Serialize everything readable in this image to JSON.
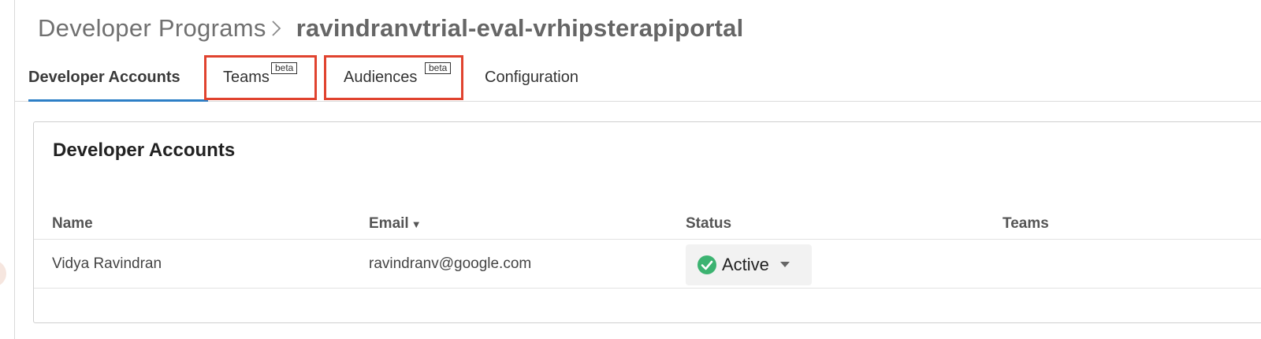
{
  "breadcrumb": {
    "parent": "Developer Programs",
    "current": "ravindranvtrial-eval-vrhipsterapiportal"
  },
  "tabs": [
    {
      "label": "Developer Accounts",
      "active": true
    },
    {
      "label": "Teams",
      "badge": "beta"
    },
    {
      "label": "Audiences",
      "badge": "beta"
    },
    {
      "label": "Configuration"
    }
  ],
  "card": {
    "title": "Developer Accounts",
    "columns": [
      "Name",
      "Email",
      "Status",
      "Teams"
    ],
    "sort_column": "Email",
    "rows": [
      {
        "name": "Vidya Ravindran",
        "email": "ravindranv@google.com",
        "status": "Active",
        "teams": ""
      }
    ]
  },
  "colors": {
    "accent_underline": "#2d7fc6",
    "highlight_box": "#e0432f",
    "status_active": "#3cb371"
  },
  "icons": {
    "breadcrumb_separator": "chevron-right-icon",
    "status": "check-circle-icon",
    "dropdown": "caret-down-icon",
    "sort": "sort-desc-icon"
  }
}
